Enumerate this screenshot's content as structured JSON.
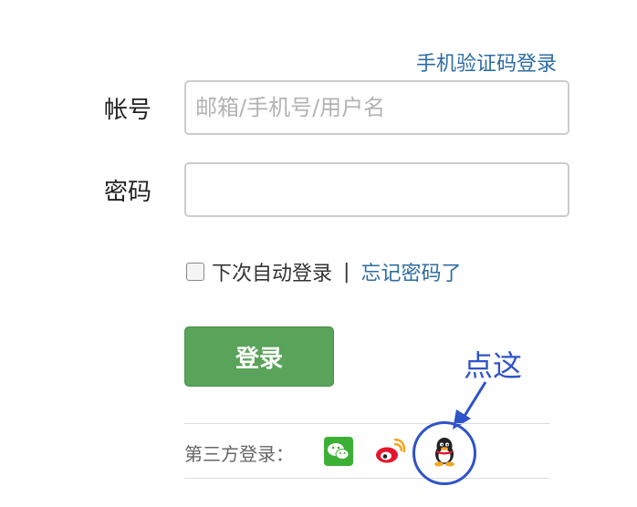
{
  "header": {
    "sms_login_link": "手机验证码登录"
  },
  "form": {
    "account_label": "帐号",
    "account_placeholder": "邮箱/手机号/用户名",
    "account_value": "",
    "password_label": "密码",
    "password_value": "",
    "remember_label": "下次自动登录",
    "separator": "|",
    "forgot_link": "忘记密码了",
    "remember_checked": false,
    "login_button": "登录"
  },
  "third_party": {
    "label": "第三方登录：",
    "providers": [
      {
        "name": "wechat",
        "icon": "wechat-icon"
      },
      {
        "name": "weibo",
        "icon": "weibo-icon"
      },
      {
        "name": "qq",
        "icon": "qq-icon"
      }
    ]
  },
  "annotation": {
    "text": "点这",
    "color": "#2f53c8"
  },
  "colors": {
    "link": "#2d6ca2",
    "button": "#5aa35a",
    "wechat": "#3cb034",
    "weibo": "#e6162d"
  }
}
